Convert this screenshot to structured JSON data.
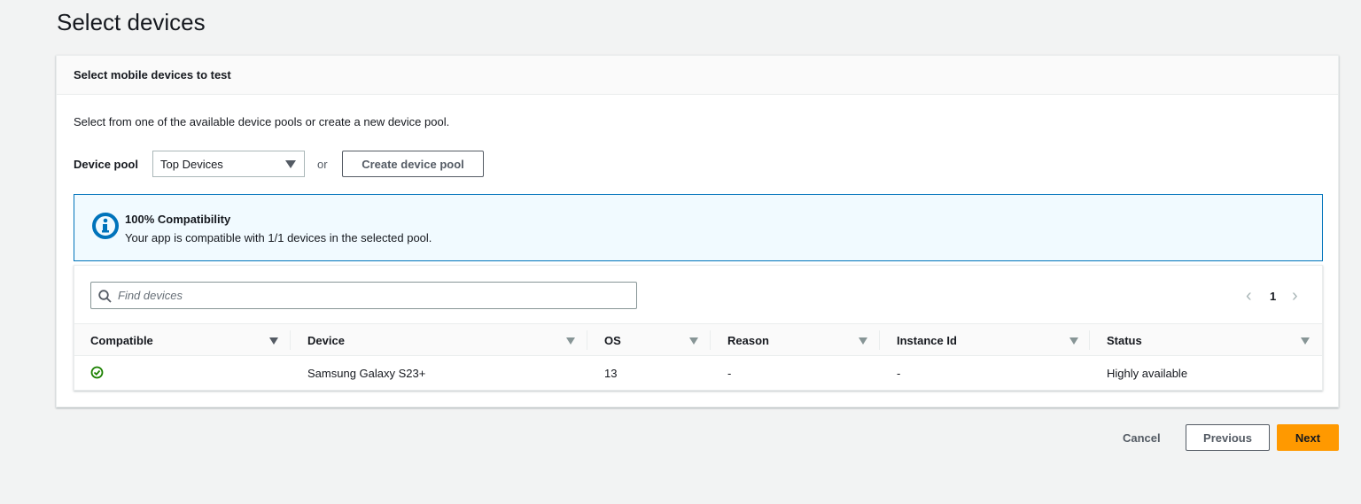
{
  "page_title": "Select devices",
  "section": {
    "title": "Select mobile devices to test",
    "description": "Select from one of the available device pools or create a new device pool.",
    "device_pool_label": "Device pool",
    "device_pool_value": "Top Devices",
    "or_label": "or",
    "create_pool_label": "Create device pool"
  },
  "info": {
    "title": "100% Compatibility",
    "message": "Your app is compatible with 1/1 devices in the selected pool.",
    "icon": "info-icon"
  },
  "table": {
    "search_placeholder": "Find devices",
    "page": "1",
    "columns": [
      "Compatible",
      "Device",
      "OS",
      "Reason",
      "Instance Id",
      "Status"
    ],
    "rows": [
      {
        "compatible": "check-circle-icon",
        "device": "Samsung Galaxy S23+",
        "os": "13",
        "reason": "-",
        "instance_id": "-",
        "status": "Highly available"
      }
    ]
  },
  "footer": {
    "cancel": "Cancel",
    "previous": "Previous",
    "next": "Next"
  },
  "colors": {
    "accent": "#ff9900",
    "info": "#0073bb",
    "success": "#1d8102"
  }
}
